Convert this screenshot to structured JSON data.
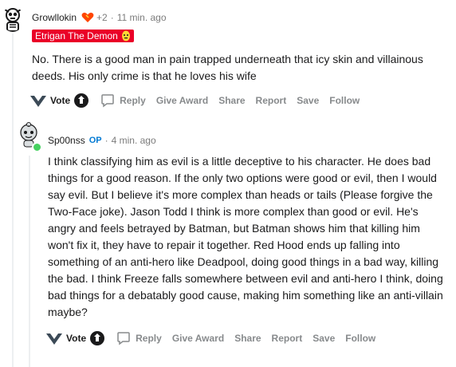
{
  "comments": [
    {
      "author": "Growllokin",
      "award_count": "+2",
      "time": "11 min. ago",
      "flair": "Etrigan The Demon",
      "body": "No. There is a good man in pain trapped underneath that icy skin and villainous deeds. His only crime is that he loves his wife",
      "actions": {
        "vote": "Vote",
        "reply": "Reply",
        "give_award": "Give Award",
        "share": "Share",
        "report": "Report",
        "save": "Save",
        "follow": "Follow"
      }
    },
    {
      "author": "Sp00nss",
      "op_badge": "OP",
      "time": "4 min. ago",
      "body": "I think classifying him as evil is a little deceptive to his character. He does bad things for a good reason. If the only two options were good or evil, then I would say evil. But I believe it's more complex than heads or tails (Please forgive the Two-Face joke). Jason Todd I think is more complex than good or evil. He's angry and feels betrayed by Batman, but Batman shows him that killing him won't fix it, they have to repair it together. Red Hood ends up falling into something of an anti-hero like Deadpool, doing good things in a bad way, killing the bad. I think Freeze falls somewhere between evil and anti-hero I think, doing bad things for a debatably good cause, making him something like an anti-villain maybe?",
      "actions": {
        "vote": "Vote",
        "reply": "Reply",
        "give_award": "Give Award",
        "share": "Share",
        "report": "Report",
        "save": "Save",
        "follow": "Follow"
      }
    }
  ],
  "colors": {
    "flair_bg": "#ea0027",
    "op": "#0079d3",
    "online": "#46d160",
    "muted": "#878a8c"
  },
  "icons": [
    "avatar-skeleton",
    "award-heart-icon",
    "flair-mask-icon",
    "upvote-arrow-icon",
    "downvote-icon",
    "reply-bubble-icon",
    "avatar-snoo",
    "online-dot"
  ]
}
